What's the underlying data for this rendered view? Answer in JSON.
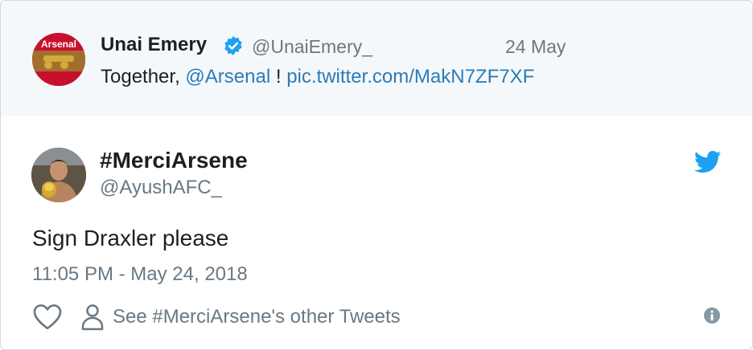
{
  "quoted_tweet": {
    "avatar_text": "Arsenal",
    "author_name": "Unai Emery",
    "handle": "@UnaiEmery_",
    "date": "24 May",
    "text_prefix": "Together, ",
    "mention": "@Arsenal",
    "text_middle": " ! ",
    "link": "pic.twitter.com/MakN7ZF7XF"
  },
  "tweet": {
    "author_name": "#MerciArsene",
    "handle": "@AyushAFC_",
    "text": "Sign Draxler please",
    "timestamp": "11:05 PM - May 24, 2018"
  },
  "actions": {
    "see_more_label": "See #MerciArsene's other Tweets"
  },
  "icons": {
    "verified": "verified-badge-icon",
    "twitter": "twitter-bird-icon",
    "like": "heart-icon",
    "profile": "person-icon",
    "info": "info-icon"
  },
  "colors": {
    "link": "#2b7bb9",
    "secondary_text": "#697882",
    "twitter_blue": "#1da1f2",
    "quoted_background": "#f5f8fa"
  }
}
